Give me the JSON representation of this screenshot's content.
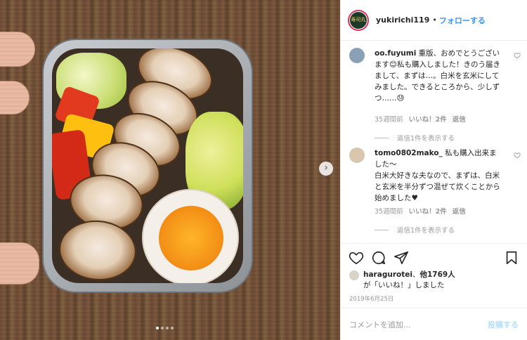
{
  "header": {
    "avatar_text": "寿司丸",
    "username": "yukirichi119",
    "separator": "•",
    "follow_label": "フォローする"
  },
  "comments": [
    {
      "username": "oo.fuyumi",
      "text": "重版、おめでとうございます😊私も購入しました！きのう届きまして、まずは…。白米を玄米にしてみました。できるところから、少しずつ……😓",
      "time": "35週間前",
      "likes": "いいね！2件",
      "reply": "返信",
      "view_replies": "返信1件を表示する"
    },
    {
      "username": "tomo0802mako_",
      "text": "私も購入出来ました〜\n白米大好きな夫なので、まずは、白米と玄米を半分ずつ混ぜて炊くことから始めました♥",
      "time": "35週間前",
      "likes": "いいね！2件",
      "reply": "返信",
      "view_replies": "返信1件を表示する"
    }
  ],
  "likes": {
    "user": "haragurotei",
    "others": "他1769人",
    "suffix": "が「いいね！」しました"
  },
  "date": "2019年6月25日",
  "add_comment": {
    "placeholder": "コメントを追加...",
    "post_label": "投稿する"
  },
  "photo": {
    "next_arrow": "›"
  },
  "colors": {
    "link_blue": "#3897f0",
    "post_disabled": "#b2dffc",
    "muted": "#999999"
  }
}
